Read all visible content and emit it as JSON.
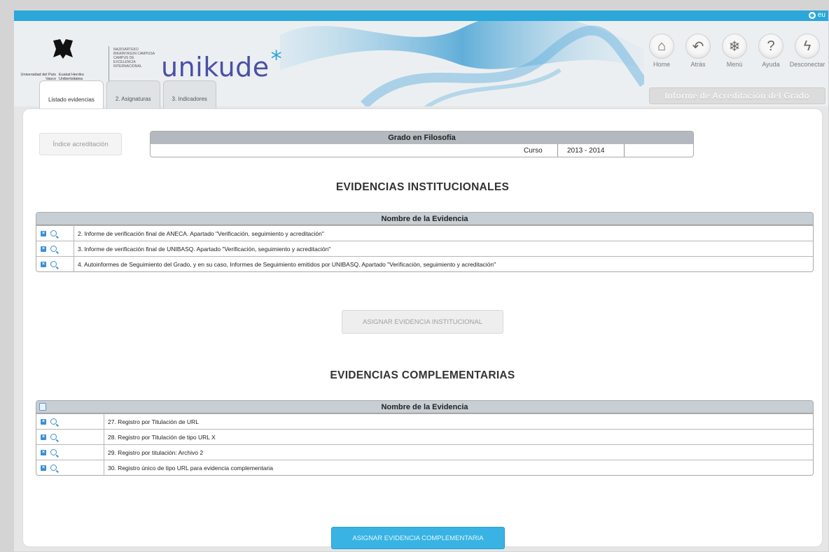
{
  "topbar": {
    "lang_label": "eu",
    "lang_icon": "globe-icon"
  },
  "logos": {
    "upv_left": "Universidad del País Vasco",
    "upv_right": "Euskal Herriko Unibertsitatea",
    "campus": "NAZIOARTEKO BIKAINTASUN CAMPUSA CAMPUS DE EXCELENCIA INTERNACIONAL",
    "brand": "unikude",
    "brand_star": "*"
  },
  "nav": [
    {
      "label": "Home",
      "icon": "home-icon",
      "glyph": "⌂"
    },
    {
      "label": "Atrás",
      "icon": "back-icon",
      "glyph": "↶"
    },
    {
      "label": "Menú",
      "icon": "menu-icon",
      "glyph": "❄"
    },
    {
      "label": "Ayuda",
      "icon": "help-icon",
      "glyph": "?"
    },
    {
      "label": "Desconectar",
      "icon": "disconnect-icon",
      "glyph": "ϟ"
    }
  ],
  "report_button": "Informe de Acreditación del Grado",
  "tabs": [
    {
      "label": "Listado evidencias",
      "active": true
    },
    {
      "label": "2. Asignaturas",
      "active": false
    },
    {
      "label": "3. Indicadores",
      "active": false
    }
  ],
  "indice_button": "Índice acreditación",
  "grado": {
    "title": "Grado en Filosofía",
    "curso_label": "Curso",
    "curso_value": "2013 - 2014"
  },
  "institucionales": {
    "title": "EVIDENCIAS INSTITUCIONALES",
    "header": "Nombre de la Evidencia",
    "rows": [
      "2. Informe de verificación final de ANECA. Apartado \"Verificación, seguimiento y acreditación\"",
      "3. Informe de verificación final de UNIBASQ. Apartado \"Verificación, seguimiento y acreditación\"",
      "4. Autoinformes de Seguimiento del Grado, y en su caso, Informes de Seguimiento emitidos por UNIBASQ. Apartado \"Verificación, seguimiento y acreditación\""
    ],
    "assign_button": "ASIGNAR EVIDENCIA INSTITUCIONAL"
  },
  "complementarias": {
    "title": "EVIDENCIAS COMPLEMENTARIAS",
    "header": "Nombre de la Evidencia",
    "rows": [
      "27. Registro por Titulación de URL",
      "28. Registro por Titulación de tipo URL X",
      "29. Registro por titulación: Archivo 2",
      "30. Registro único de tipo URL para evidencia complementaria"
    ],
    "assign_button": "ASIGNAR EVIDENCIA COMPLEMENTARIA"
  }
}
